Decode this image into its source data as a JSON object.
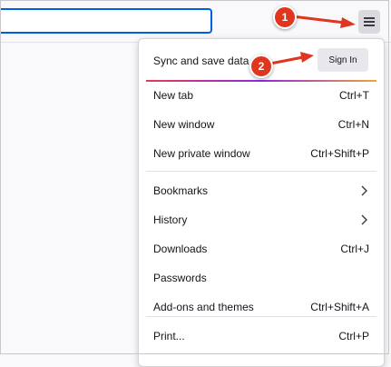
{
  "menu": {
    "sync": {
      "label": "Sync and save data",
      "signin_label": "Sign In"
    },
    "groups": [
      [
        {
          "label": "New tab",
          "shortcut": "Ctrl+T"
        },
        {
          "label": "New window",
          "shortcut": "Ctrl+N"
        },
        {
          "label": "New private window",
          "shortcut": "Ctrl+Shift+P"
        }
      ],
      [
        {
          "label": "Bookmarks",
          "submenu": true
        },
        {
          "label": "History",
          "submenu": true
        },
        {
          "label": "Downloads",
          "shortcut": "Ctrl+J"
        },
        {
          "label": "Passwords"
        },
        {
          "label": "Add-ons and themes",
          "shortcut": "Ctrl+Shift+A"
        }
      ],
      [
        {
          "label": "Print...",
          "shortcut": "Ctrl+P"
        }
      ]
    ]
  },
  "annotations": {
    "step1": "1",
    "step2": "2",
    "arrow_color": "#e0351f"
  },
  "icons": {
    "menu_button": "hamburger-menu-icon",
    "submenu": "chevron-right-icon"
  }
}
